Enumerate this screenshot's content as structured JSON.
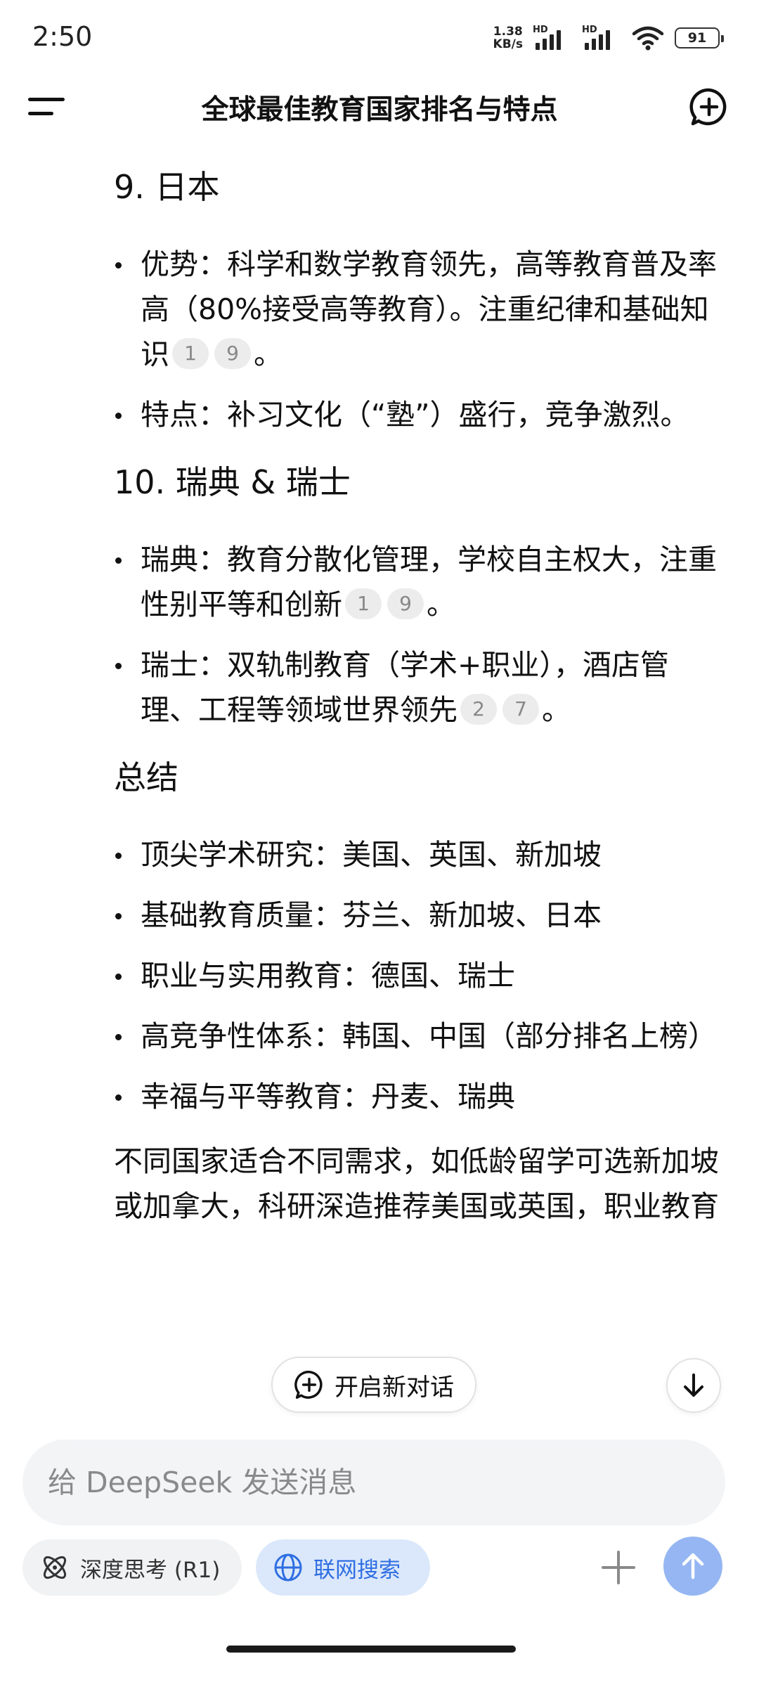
{
  "status_bar": {
    "time": "2:50",
    "net_speed_value": "1.38",
    "net_speed_unit": "KB/s",
    "signal_1_label": "HD",
    "signal_2_label": "HD",
    "battery": "91"
  },
  "header": {
    "title": "全球最佳教育国家排名与特点",
    "menu_icon": "menu-icon",
    "new_chat_icon": "new-chat-icon"
  },
  "content": {
    "sections": [
      {
        "heading": "9. 日本",
        "items": [
          {
            "text": "优势：科学和数学教育领先，高等教育普及率高（80%接受高等教育）。注重纪律和基础知识",
            "cites": [
              "1",
              "9"
            ],
            "tail": "。"
          },
          {
            "text": "特点：补习文化（“塾”）盛行，竞争激烈。",
            "cites": [],
            "tail": ""
          }
        ]
      },
      {
        "heading": "10. 瑞典 & 瑞士",
        "items": [
          {
            "text": "瑞典：教育分散化管理，学校自主权大，注重性别平等和创新",
            "cites": [
              "1",
              "9"
            ],
            "tail": "。"
          },
          {
            "text": "瑞士：双轨制教育（学术+职业），酒店管理、工程等领域世界领先",
            "cites": [
              "2",
              "7"
            ],
            "tail": "。"
          }
        ]
      },
      {
        "heading": "总结",
        "items": [
          {
            "text": "顶尖学术研究：美国、英国、新加坡",
            "cites": [],
            "tail": ""
          },
          {
            "text": "基础教育质量：芬兰、新加坡、日本",
            "cites": [],
            "tail": ""
          },
          {
            "text": "职业与实用教育：德国、瑞士",
            "cites": [],
            "tail": ""
          },
          {
            "text": "高竞争性体系：韩国、中国（部分排名上榜）",
            "cites": [],
            "tail": ""
          },
          {
            "text": "幸福与平等教育：丹麦、瑞典",
            "cites": [],
            "tail": ""
          }
        ]
      }
    ],
    "closing_paragraph": "不同国家适合不同需求，如低龄留学可选新加坡或加拿大，科研深造推荐美国或英国，职业教育"
  },
  "floating": {
    "new_chat_label": "开启新对话",
    "scroll_down_icon": "arrow-down-icon"
  },
  "composer": {
    "placeholder": "给 DeepSeek 发送消息"
  },
  "tools": {
    "deep_think_label": "深度思考 (R1)",
    "web_search_label": "联网搜索"
  },
  "colors": {
    "accent": "#2f6ee2",
    "send_button": "#95b6f2",
    "search_chip_bg": "#dbe8fb",
    "citation_bg": "#ececec"
  }
}
